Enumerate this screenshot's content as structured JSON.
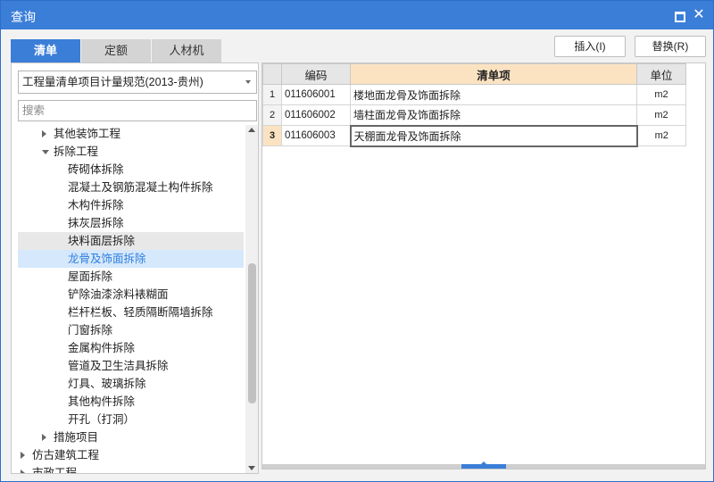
{
  "window": {
    "title": "查询"
  },
  "tabs": [
    {
      "label": "清单",
      "active": true
    },
    {
      "label": "定额",
      "active": false
    },
    {
      "label": "人材机",
      "active": false
    }
  ],
  "actions": {
    "insert_label": "插入(I)",
    "replace_label": "替换(R)"
  },
  "left": {
    "spec_select": "工程量清单项目计量规范(2013-贵州)",
    "search_placeholder": "搜索",
    "tree": [
      {
        "label": "其他装饰工程",
        "level": 1,
        "caret": "right"
      },
      {
        "label": "拆除工程",
        "level": 1,
        "caret": "down"
      },
      {
        "label": "砖砌体拆除",
        "level": 2
      },
      {
        "label": "混凝土及钢筋混凝土构件拆除",
        "level": 2
      },
      {
        "label": "木构件拆除",
        "level": 2
      },
      {
        "label": "抹灰层拆除",
        "level": 2
      },
      {
        "label": "块料面层拆除",
        "level": 2,
        "state": "hover"
      },
      {
        "label": "龙骨及饰面拆除",
        "level": 2,
        "state": "selected"
      },
      {
        "label": "屋面拆除",
        "level": 2
      },
      {
        "label": "铲除油漆涂料裱糊面",
        "level": 2
      },
      {
        "label": "栏杆栏板、轻质隔断隔墙拆除",
        "level": 2
      },
      {
        "label": "门窗拆除",
        "level": 2
      },
      {
        "label": "金属构件拆除",
        "level": 2
      },
      {
        "label": "管道及卫生洁具拆除",
        "level": 2
      },
      {
        "label": "灯具、玻璃拆除",
        "level": 2
      },
      {
        "label": "其他构件拆除",
        "level": 2
      },
      {
        "label": "开孔（打洞）",
        "level": 2
      },
      {
        "label": "措施项目",
        "level": 1,
        "caret": "right"
      },
      {
        "label": "仿古建筑工程",
        "level": 0,
        "caret": "right"
      },
      {
        "label": "市政工程",
        "level": 0,
        "caret": "right"
      }
    ]
  },
  "grid": {
    "headers": {
      "code": "编码",
      "item": "清单项",
      "unit": "单位"
    },
    "rows": [
      {
        "idx": "1",
        "code": "011606001",
        "item": "楼地面龙骨及饰面拆除",
        "unit": "m2"
      },
      {
        "idx": "2",
        "code": "011606002",
        "item": "墙柱面龙骨及饰面拆除",
        "unit": "m2"
      },
      {
        "idx": "3",
        "code": "011606003",
        "item": "天棚面龙骨及饰面拆除",
        "unit": "m2"
      }
    ]
  },
  "colors": {
    "accent": "#3b7ed8",
    "header_highlight": "#fbe3c2",
    "selected_bg": "#d6e8fb"
  }
}
